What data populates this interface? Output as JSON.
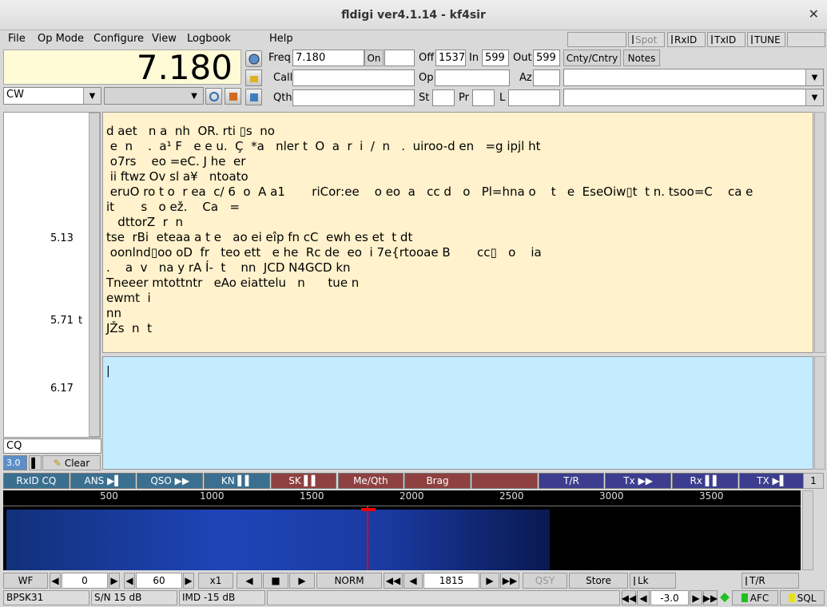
{
  "window": {
    "title": "fldigi ver4.1.14 - kf4sir",
    "close": "✕"
  },
  "menu": {
    "file": "File",
    "opmode": "Op Mode",
    "configure": "Configure",
    "view": "View",
    "logbook": "Logbook",
    "help": "Help"
  },
  "topbtns": {
    "spot": "Spot",
    "rxid": "RxID",
    "txid": "TxID",
    "tune": "TUNE"
  },
  "freq_display": "7.180",
  "log": {
    "freq_label": "Freq",
    "freq": "7.180",
    "on_label": "On",
    "on": "",
    "off_label": "Off",
    "off": "1537",
    "in_label": "In",
    "in": "599",
    "out_label": "Out",
    "out": "599",
    "cnty": "Cnty/Cntry",
    "notes": "Notes",
    "call_label": "Call",
    "call": "",
    "op_label": "Op",
    "op": "",
    "az_label": "Az",
    "az": "",
    "qth_label": "Qth",
    "qth": "",
    "st_label": "St",
    "st": "",
    "pr_label": "Pr",
    "pr": "",
    "l_label": "L",
    "l": ""
  },
  "mode": "CW",
  "scale": [
    {
      "v": "5.13",
      "s": ""
    },
    {
      "v": "5.71",
      "s": "t"
    },
    {
      "v": "6.17",
      "s": ""
    }
  ],
  "left_search": "CQ",
  "left_ctrl": {
    "speed": "3.0",
    "clear": "Clear"
  },
  "rx_text": "d aet   n a  nh  OR. rti ▯s  no\n e  n    .  a¹ F   e e u.  Ç  *a   nler t  O  a  r  i  /  n   .  uiroo-d en   =g ipjl ht\n o7rs    eo =eC. J he  er\n ii ftwz Ov sl a¥   ntoato\n eruO ro t o  r ea  c/ 6  o  A a1       riCor:ee    o eo  a   cc d   o   Pl=hna o    t   e  EseOiw▯t  t n. tsoo=C    ca e\nit       s   o ež.    Ca   =\n   dttorZ  r  n\ntse  rBi  eteaa a t e   ao ei eîp fn cC  ewh es et  t dt\n oonlnd▯oo oD  fr   teo ett   e he  Rc de  eo  i 7e{rtooae B       cc▯   o    ia\n.    a  v   na y rA Í-  t    nn  JCD N4GCD kn\nTneeer mtottntr   eAo eiattelu   n      tue n\newmt  i\nnn\nJŽs  n  t",
  "macros": [
    {
      "label": "RxID CQ",
      "color": "#3a6f8f"
    },
    {
      "label": "ANS ▶▌",
      "color": "#3a6f8f"
    },
    {
      "label": "QSO ▶▶",
      "color": "#3a6f8f"
    },
    {
      "label": "KN ▌▌",
      "color": "#3a6f8f"
    },
    {
      "label": "SK ▌▌",
      "color": "#8f4040"
    },
    {
      "label": "Me/Qth",
      "color": "#8f4040"
    },
    {
      "label": "Brag",
      "color": "#8f4040"
    },
    {
      "label": "",
      "color": "#8f4040"
    },
    {
      "label": "T/R",
      "color": "#3d3d8f"
    },
    {
      "label": "Tx ▶▶",
      "color": "#3d3d8f"
    },
    {
      "label": "Rx ▌▌",
      "color": "#3d3d8f"
    },
    {
      "label": "TX ▶▌",
      "color": "#3d3d8f"
    }
  ],
  "macro_set": "1",
  "wf_scale": [
    "500",
    "1000",
    "1500",
    "2000",
    "2500",
    "3000",
    "3500"
  ],
  "wf_ctrl": {
    "wf": "WF",
    "offset": "0",
    "range": "60",
    "zoom": "x1",
    "speed": "NORM",
    "freq": "1815",
    "qsy": "QSY",
    "store": "Store",
    "lk": "Lk",
    "tr": "T/R"
  },
  "status": {
    "mode": "BPSK31",
    "sn": "S/N 15 dB",
    "imd": "IMD -15 dB",
    "msg": "",
    "att": "-3.0",
    "afc": "AFC",
    "sql": "SQL"
  },
  "colors": {
    "rx_bg": "#fff2cc",
    "tx_bg": "#c4ebff",
    "freq_bg": "#fffbd6"
  }
}
